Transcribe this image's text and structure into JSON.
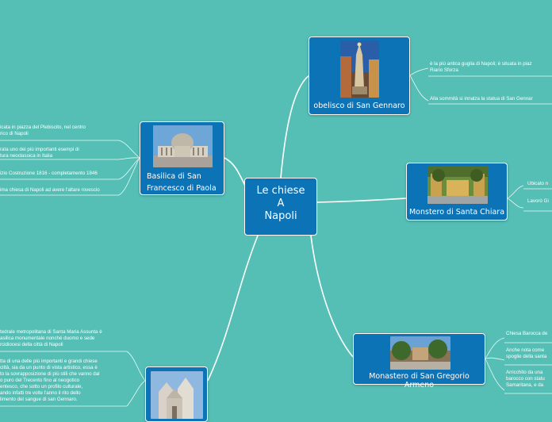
{
  "center": {
    "line1": "Le chiese",
    "line2": "A",
    "line3": "Napoli"
  },
  "nodes": {
    "obelisco": {
      "title": "obelisco di San Gennaro",
      "leaves": [
        "è la più antica guglia di Napoli; è situata in piaz\nRiario Sforza",
        "Alla sommità si innalza la statua di San Gennar"
      ]
    },
    "basilica": {
      "title": "Basilica di San\nFrancesco di Paola",
      "leaves": [
        "icata in piazza del Plebiscito, nel centro\nrico di Napoli",
        "rata uno dei più importanti esempi di\ntura neoclassica in Italia",
        "izio Costruzione 1816 - completamento 1846",
        "ima chiesa di Napoli ad avere l'altare rovescio"
      ]
    },
    "chiara": {
      "title": "Monstero di Santa Chiara",
      "leaves": [
        "Ubicato n",
        "Lavorò Gi"
      ]
    },
    "gregorio": {
      "title": "Monastero di San Gregorio Armeno",
      "leaves": [
        "Chiesa Barocca de",
        "Anche nota come\nspoglie della santa",
        "Arricchito da una\nbarocco con statu\nSamaritana, e da"
      ]
    },
    "duomo": {
      "leaves": [
        "tedrale metropolitana di Santa Maria Assunta è\nasilica monumentale nonché duomo e sede\nrcidiocesi della città di Napoli",
        "tta di una delle più importanti e grandi chiese\ncittà, sia da un punto di vista artistico, essa è\nto la sovrapposizione di più stili che vanno dal\no puro del Trecento fino al neogotico\nentesco, che sotto un profilo culturale,\nando infatti tre volte l'anno il rito dello\nlimento del sangue di san Gennaro."
      ]
    }
  },
  "colors": {
    "background": "#55bfb6",
    "node": "#0c73b7",
    "line": "#ffffff"
  }
}
